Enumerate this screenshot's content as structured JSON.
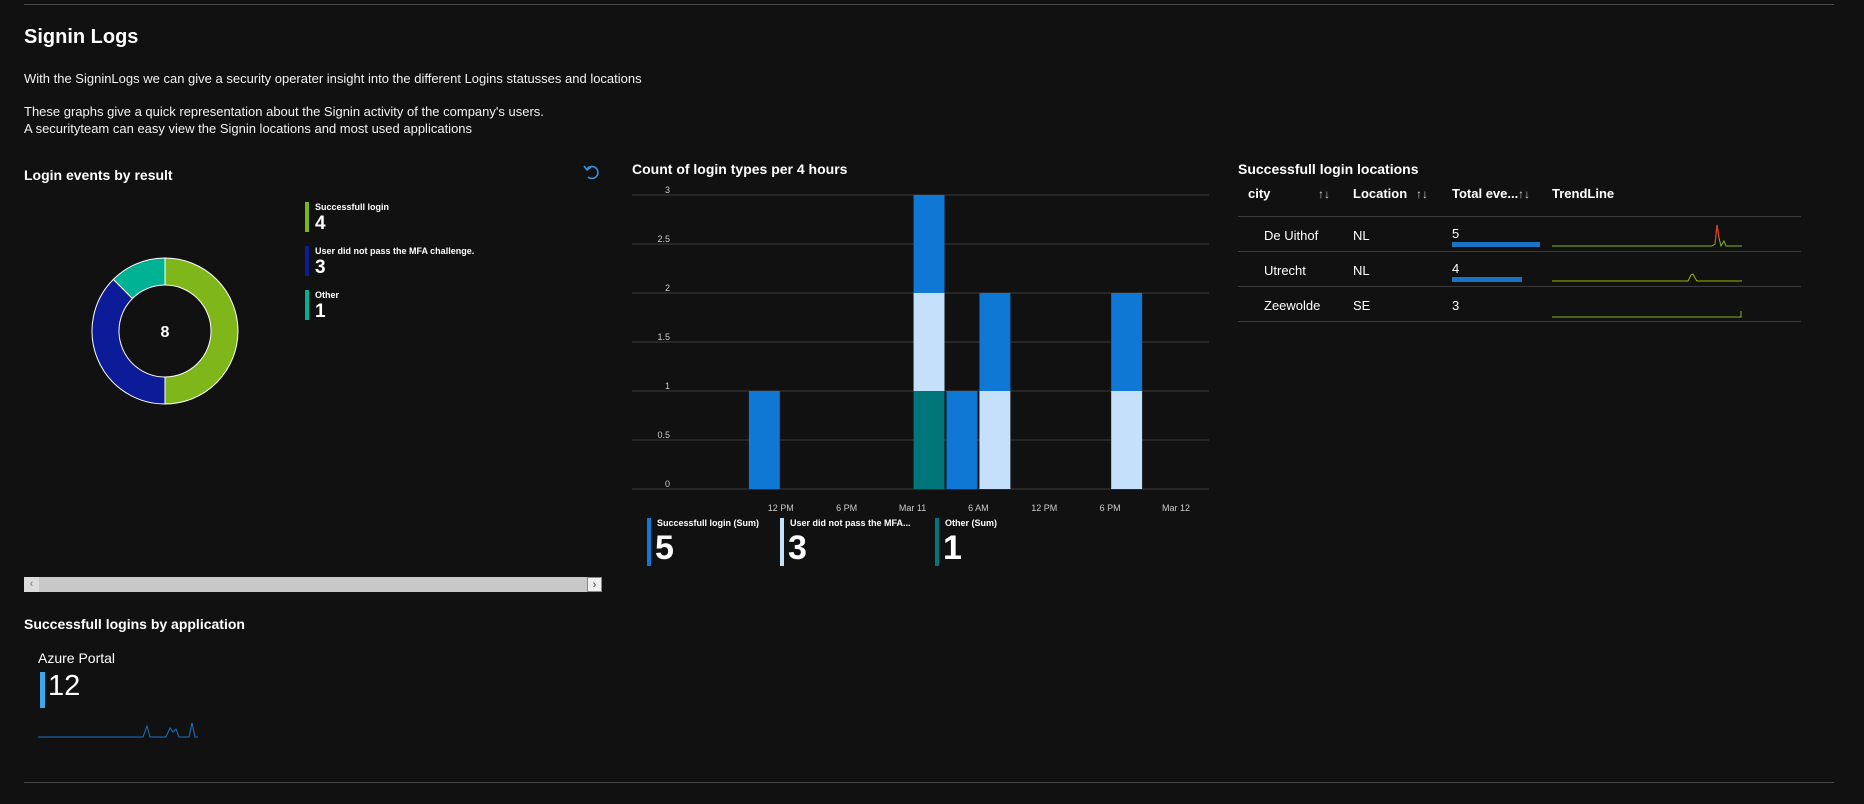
{
  "header": {
    "title": "Signin Logs",
    "description_line1": "With the SigninLogs we can give a security operater insight into the different Logins statusses and locations",
    "description_line2": "These graphs give a quick representation about the Signin activity of the company's users.",
    "description_line3": "A securityteam can easy view the Signin locations and most used applications"
  },
  "donut": {
    "title": "Login events by result",
    "total": "8",
    "items": [
      {
        "label": "Successfull login",
        "value": "4",
        "color": "#7fb71a"
      },
      {
        "label": "User did not pass the MFA challenge.",
        "value": "3",
        "color": "#0c1c99"
      },
      {
        "label": "Other",
        "value": "1",
        "color": "#00b294"
      }
    ]
  },
  "bar_chart": {
    "title": "Count of login types per 4 hours",
    "legend": [
      {
        "label": "Successfull login (Sum)",
        "value": "5",
        "color": "#0f78d4"
      },
      {
        "label": "User did not pass the MFA...",
        "value": "3",
        "color": "#c4e0fa"
      },
      {
        "label": "Other (Sum)",
        "value": "1",
        "color": "#00757a"
      }
    ]
  },
  "chart_data": {
    "type": "bar",
    "stacked": true,
    "y_ticks": [
      "0",
      "0.5",
      "1",
      "1.5",
      "2",
      "2.5",
      "3"
    ],
    "ylim": [
      0,
      3
    ],
    "x_tick_labels": [
      "12 PM",
      "6 PM",
      "Mar 11",
      "6 AM",
      "12 PM",
      "6 PM",
      "Mar 12"
    ],
    "series": [
      {
        "name": "Successfull login (Sum)",
        "color": "#0f78d4",
        "values": [
          1,
          0,
          0,
          0,
          1,
          1,
          1,
          0,
          0,
          1
        ]
      },
      {
        "name": "User did not pass the MFA...",
        "color": "#c4e0fa",
        "values": [
          0,
          0,
          0,
          0,
          1,
          0,
          1,
          0,
          0,
          1
        ]
      },
      {
        "name": "Other (Sum)",
        "color": "#00757a",
        "values": [
          0,
          0,
          0,
          0,
          1,
          0,
          0,
          0,
          0,
          0
        ]
      }
    ]
  },
  "locations": {
    "title": "Successfull login locations",
    "columns": {
      "city": "city",
      "location": "Location",
      "total": "Total eve...",
      "trend": "TrendLine"
    },
    "sort_icon": "↑↓",
    "rows": [
      {
        "city": "De Uithof",
        "location": "NL",
        "total": "5",
        "total_value": 5,
        "spark": "#e33c1e"
      },
      {
        "city": "Utrecht",
        "location": "NL",
        "total": "4",
        "total_value": 4,
        "spark": "#c8c800"
      },
      {
        "city": "Zeewolde",
        "location": "SE",
        "total": "3",
        "total_value": 3,
        "spark": "#7fb71a"
      }
    ]
  },
  "applications": {
    "title": "Successfull logins by application",
    "name": "Azure Portal",
    "value": "12",
    "bar_color": "#3ea7e8"
  }
}
